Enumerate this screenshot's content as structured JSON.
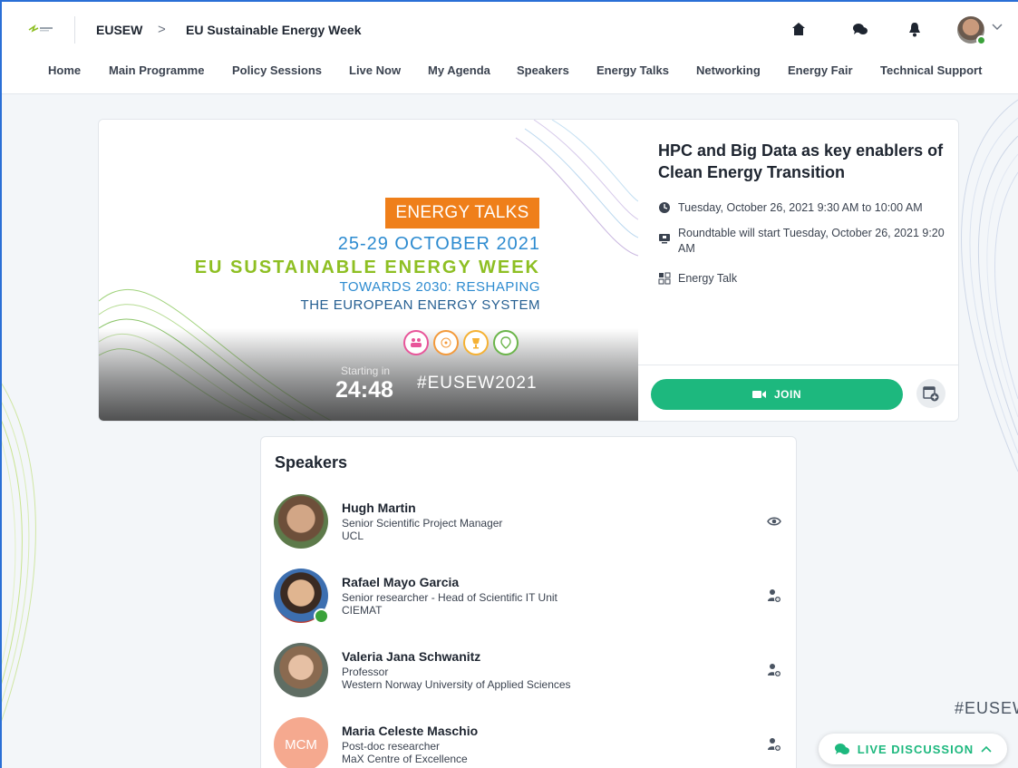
{
  "header": {
    "breadcrumb_root": "EUSEW",
    "breadcrumb_separator": ">",
    "breadcrumb_current": "EU Sustainable Energy Week",
    "icons": [
      "home-icon",
      "chat-icon",
      "bell-icon",
      "avatar",
      "chevron-down-icon"
    ]
  },
  "nav": {
    "items": [
      "Home",
      "Main Programme",
      "Policy Sessions",
      "Live Now",
      "My Agenda",
      "Speakers",
      "Energy Talks",
      "Networking",
      "Energy Fair",
      "Technical Support"
    ]
  },
  "banner": {
    "tag": "ENERGY TALKS",
    "dates": "25-29 OCTOBER 2021",
    "event": "EU SUSTAINABLE ENERGY WEEK",
    "towards": "TOWARDS 2030: RESHAPING",
    "system": "THE EUROPEAN ENERGY SYSTEM",
    "hashtag": "#EUSEW2021",
    "starting_label": "Starting in",
    "countdown": "24:48"
  },
  "session": {
    "title": "HPC and Big Data as key enablers of Clean Energy Transition",
    "time": "Tuesday, October 26, 2021 9:30 AM to 10:00 AM",
    "roundtable": "Roundtable will start Tuesday, October 26, 2021 9:20 AM",
    "type": "Energy Talk",
    "join_label": "JOIN"
  },
  "speakers": {
    "heading": "Speakers",
    "list": [
      {
        "name": "Hugh Martin",
        "role": "Senior Scientific Project Manager",
        "org": "UCL",
        "action": "eye-icon"
      },
      {
        "name": "Rafael Mayo Garcia",
        "role": "Senior researcher - Head of Scientific IT Unit",
        "org": "CIEMAT",
        "action": "add-contact-icon"
      },
      {
        "name": "Valeria Jana Schwanitz",
        "role": "Professor",
        "org": "Western Norway University of Applied Sciences",
        "action": "add-contact-icon"
      },
      {
        "name": "Maria Celeste Maschio",
        "role": "Post-doc researcher",
        "org": "MaX Centre of Excellence",
        "initials": "MCM",
        "action": "add-contact-icon"
      }
    ]
  },
  "footer": {
    "hashtag_partial": "#EUSEW",
    "live_discussion": "LIVE DISCUSSION"
  },
  "colors": {
    "accent_green": "#1db87e",
    "orange_tag": "#ef7f1a",
    "blue_text": "#2d8bd0",
    "lime_text": "#8ebf23",
    "online_dot": "#3aa23a"
  }
}
